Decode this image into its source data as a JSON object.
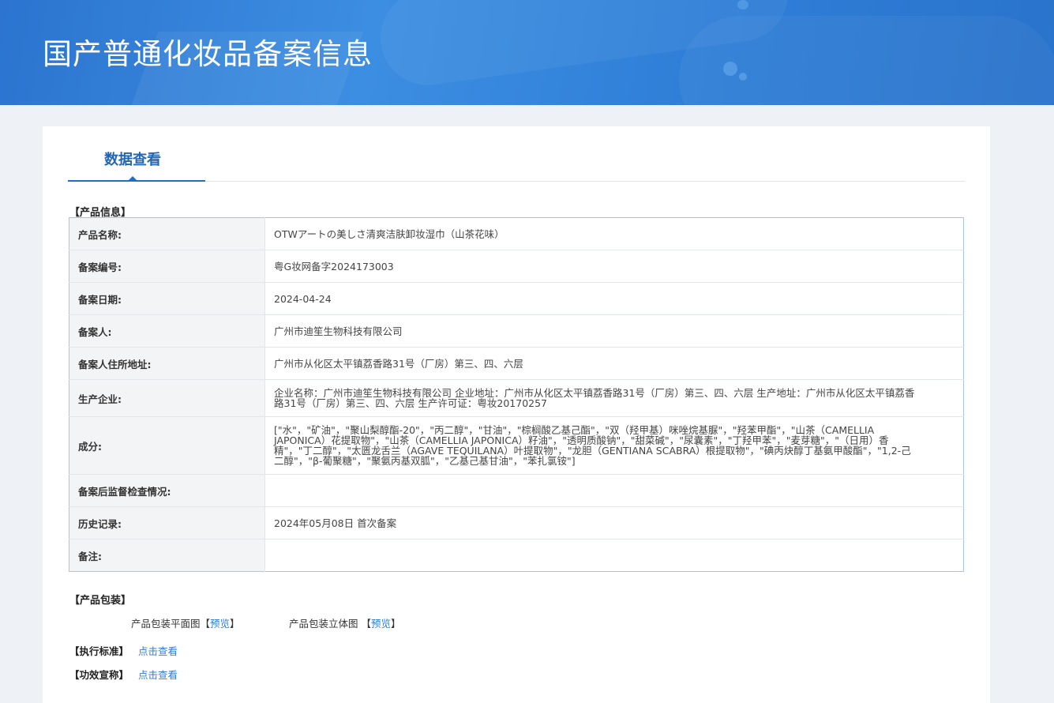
{
  "header": {
    "title": "国产普通化妆品备案信息"
  },
  "tabs": [
    {
      "label": "数据查看"
    }
  ],
  "product_info": {
    "section_title": "【产品信息】",
    "rows": [
      {
        "key": "产品名称:",
        "value": "OTWアートの美しさ清爽洁肤卸妆湿巾（山茶花味）"
      },
      {
        "key": "备案编号:",
        "value": "粤G妆网备字2024173003"
      },
      {
        "key": "备案日期:",
        "value": "2024-04-24"
      },
      {
        "key": "备案人:",
        "value": "广州市迪笙生物科技有限公司"
      },
      {
        "key": "备案人住所地址:",
        "value": "广州市从化区太平镇荔香路31号（厂房）第三、四、六层"
      },
      {
        "key": "生产企业:",
        "value": "企业名称：广州市迪笙生物科技有限公司 企业地址：广州市从化区太平镇荔香路31号（厂房）第三、四、六层 生产地址：广州市从化区太平镇荔香路31号（厂房）第三、四、六层 生产许可证：粤妆20170257"
      },
      {
        "key": "成分:",
        "value": "[\"水\"，\"矿油\"，\"聚山梨醇酯-20\"，\"丙二醇\"，\"甘油\"，\"棕榈酸乙基己酯\"，\"双（羟甲基）咪唑烷基脲\"，\"羟苯甲酯\"，\"山茶（CAMELLIA JAPONICA）花提取物\"，\"山茶（CAMELLIA JAPONICA）籽油\"，\"透明质酸钠\"，\"甜菜碱\"，\"尿囊素\"，\"丁羟甲苯\"，\"麦芽糖\"，\"（日用）香精\"，\"丁二醇\"，\"太匮龙舌兰（AGAVE TEQUILANA）叶提取物\"，\"龙胆（GENTIANA SCABRA）根提取物\"，\"碘丙炔醇丁基氨甲酸酯\"，\"1,2-己二醇\"，\"β-葡聚糖\"，\"聚氨丙基双胍\"，\"乙基己基甘油\"，\"苯扎氯铵\"]"
      },
      {
        "key": "备案后监督检查情况:",
        "value": ""
      },
      {
        "key": "历史记录:",
        "value": "2024年05月08日 首次备案"
      },
      {
        "key": "备注:",
        "value": ""
      }
    ]
  },
  "packaging": {
    "section_title": "【产品包装】",
    "flat_label": "产品包装平面图",
    "solid_label": "产品包装立体图",
    "preview_label": "预览",
    "bracket_open": "【",
    "bracket_close": "】"
  },
  "standard": {
    "label": "【执行标准】",
    "link": "点击查看"
  },
  "efficacy": {
    "label": "【功效宣称】",
    "link": "点击查看"
  }
}
